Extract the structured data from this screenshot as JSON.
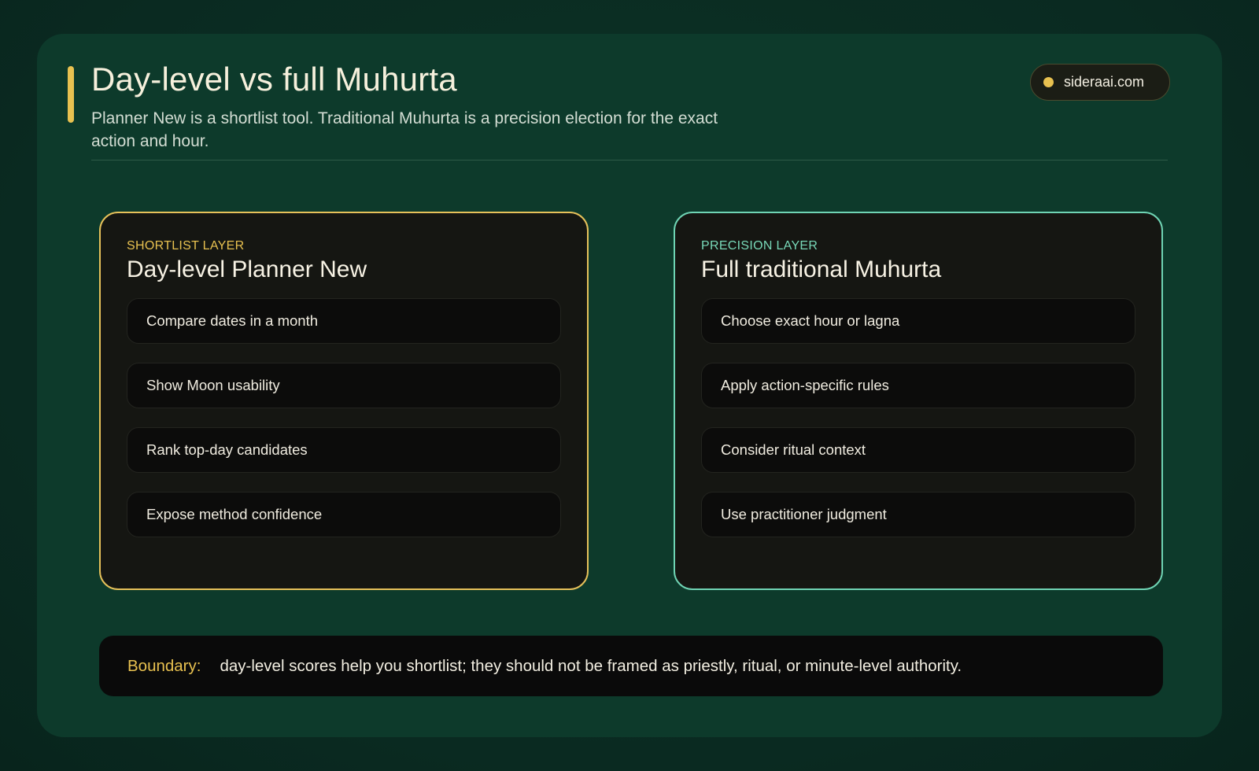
{
  "header": {
    "title": "Day-level vs full Muhurta",
    "subtitle": "Planner New is a shortlist tool. Traditional Muhurta is a precision election for the exact action and hour.",
    "site_badge": "sideraai.com"
  },
  "panels": [
    {
      "kicker": "SHORTLIST LAYER",
      "title": "Day-level Planner New",
      "accent": "#e6c15a",
      "items": [
        "Compare dates in a month",
        "Show Moon usability",
        "Rank top-day candidates",
        "Expose method confidence"
      ]
    },
    {
      "kicker": "PRECISION LAYER",
      "title": "Full traditional Muhurta",
      "accent": "#6fd4b4",
      "items": [
        "Choose exact hour or lagna",
        "Apply action-specific rules",
        "Consider ritual context",
        "Use practitioner judgment"
      ]
    }
  ],
  "boundary": {
    "label": "Boundary:",
    "text": "day-level scores help you shortlist; they should not be framed as priestly, ritual, or minute-level authority."
  },
  "colors": {
    "background": "#0a2a21",
    "card": "#0d3a2b",
    "gold": "#e8c150",
    "mint": "#6fd4b4"
  }
}
